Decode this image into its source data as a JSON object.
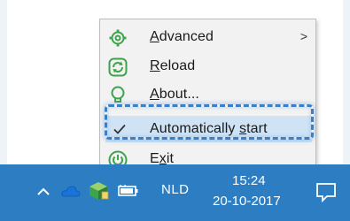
{
  "menu": {
    "items": [
      {
        "label": "Advanced",
        "accel_index": 0,
        "has_submenu": true,
        "icon": "gear-icon"
      },
      {
        "label": "Reload",
        "accel_index": 0,
        "icon": "refresh-icon"
      },
      {
        "label": "About...",
        "accel_index": 0,
        "icon": "info-bulb-icon"
      },
      {
        "label": "Automatically start",
        "accel_index": 14,
        "checked": true,
        "icon": "checkmark-icon"
      },
      {
        "label": "Exit",
        "accel_index": 1,
        "icon": "power-icon"
      }
    ],
    "submenu_arrow": ">"
  },
  "taskbar": {
    "language": "NLD",
    "time": "15:24",
    "date": "20-10-2017",
    "tray_icons": [
      "chevron-up-icon",
      "onedrive-cloud-icon",
      "app-cube-icon",
      "battery-icon"
    ],
    "notification_icon": "action-center-icon"
  },
  "colors": {
    "taskbar_bg": "#2d7dc3",
    "menu_bg": "#f2f2f2",
    "selected_bg": "#cfe3f5",
    "highlight_border": "#3b7fc4",
    "icon_green": "#3fa34d"
  }
}
